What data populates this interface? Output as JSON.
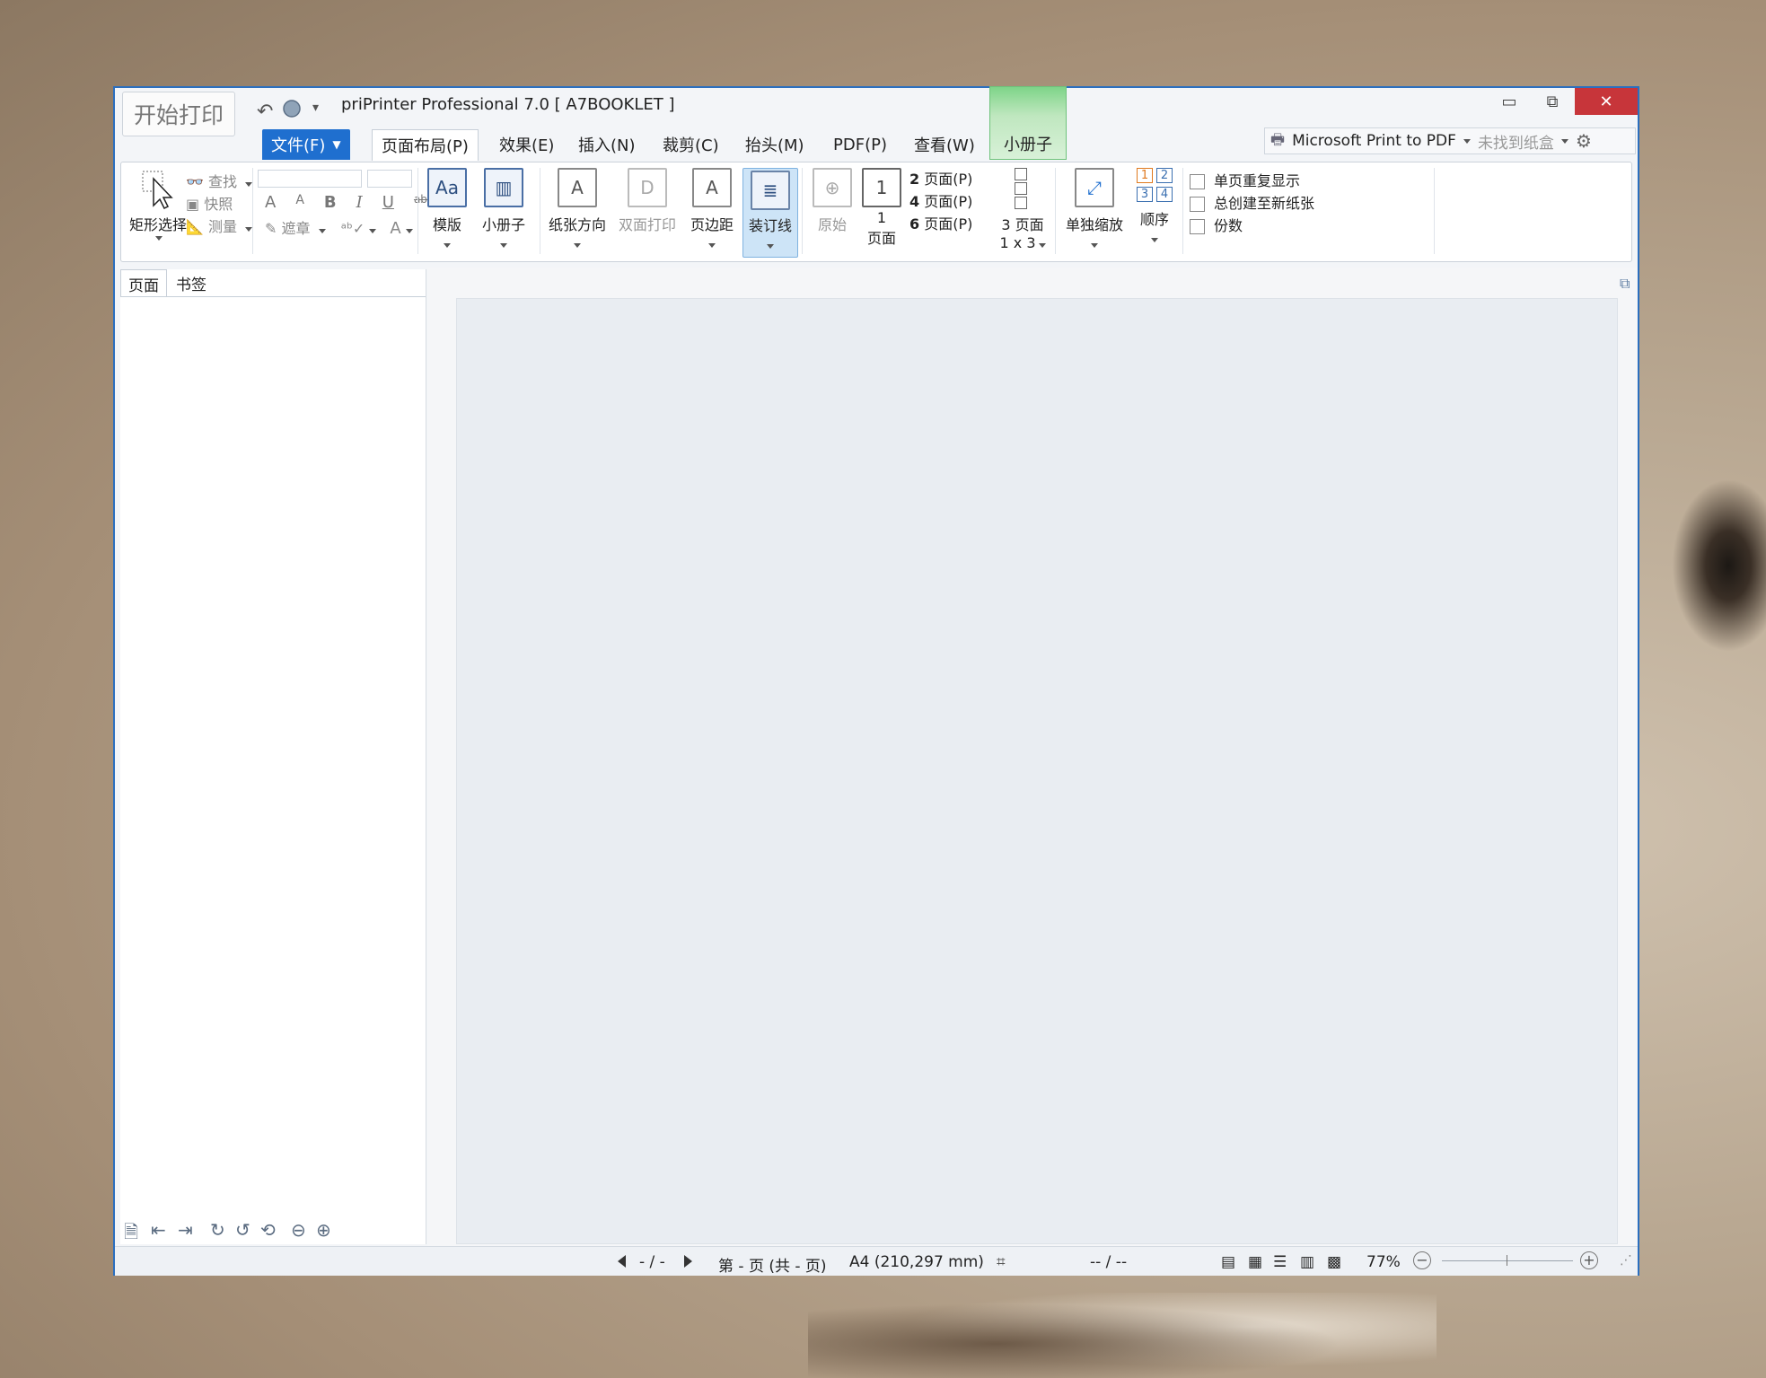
{
  "titlebar": {
    "start_print": "开始打印",
    "title": "priPrinter Professional 7.0 [ A7BOOKLET ]",
    "minimize": "▭",
    "restore": "⧉",
    "close": "✕"
  },
  "tabs": {
    "file": "文件(F)",
    "layout": "页面布局(P)",
    "effects": "效果(E)",
    "insert": "插入(N)",
    "crop": "裁剪(C)",
    "header": "抬头(M)",
    "pdf": "PDF(P)",
    "view": "查看(W)",
    "booklet": "小册子"
  },
  "printer": {
    "name": "Microsoft Print to PDF",
    "tray": "未找到纸盒"
  },
  "ribbon": {
    "rect_select": "矩形选择",
    "find": "查找",
    "snapshot": "快照",
    "measure": "测量",
    "mask": "遮章",
    "font_a_big": "A",
    "font_a_small": "A",
    "bold": "B",
    "italic": "I",
    "underline": "U",
    "strike": "abc",
    "template": "模版",
    "booklet": "小册子",
    "orientation": "纸张方向",
    "duplex": "双面打印",
    "margins": "页边距",
    "binding": "装订线",
    "original": "原始",
    "one_page_num": "1",
    "one_page": "页面",
    "two_pages_num": "2",
    "four_pages_num": "4",
    "six_pages_num": "6",
    "pages_suffix": "页面(P)",
    "three_pages": "3 页面",
    "one_by_three": "1 x 3",
    "scale_single": "单独缩放",
    "order": "顺序",
    "order_digits": [
      "1",
      "2",
      "3",
      "4"
    ],
    "repeat_single": "单页重复显示",
    "new_sheet": "总创建至新纸张",
    "copies": "份数"
  },
  "left_panel": {
    "tab_pages": "页面",
    "tab_bookmarks": "书签"
  },
  "status": {
    "page_nav": "- / -",
    "page_info": "第 - 页 (共 - 页)",
    "paper": "A4 (210,297 mm)",
    "coords": "-- / --",
    "zoom": "77%"
  },
  "colors": {
    "accent": "#1f6fcf",
    "window_border": "#2b6fbf",
    "close": "#c7353a",
    "booklet_tab": "#7ed488"
  }
}
